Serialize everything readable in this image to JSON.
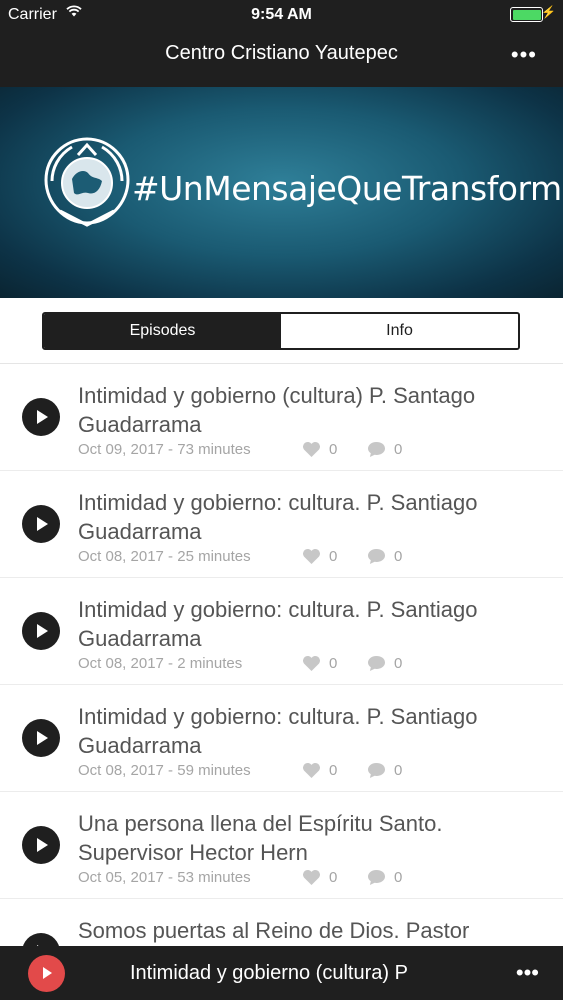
{
  "status": {
    "carrier": "Carrier",
    "time": "9:54 AM",
    "battery_level": 1.0
  },
  "nav": {
    "title": "Centro Cristiano Yautepec",
    "more_icon": "more-dots-icon"
  },
  "banner": {
    "text": "#UnMensajeQueTransforma"
  },
  "tabs": [
    {
      "label": "Episodes",
      "active": true
    },
    {
      "label": "Info",
      "active": false
    }
  ],
  "episodes": [
    {
      "title": "Intimidad y gobierno (cultura) P. Santago Guadarrama",
      "meta": "Oct 09, 2017 - 73 minutes",
      "likes": "0",
      "comments": "0"
    },
    {
      "title": "Intimidad y gobierno: cultura. P. Santiago Guadarrama",
      "meta": "Oct 08, 2017 - 25 minutes",
      "likes": "0",
      "comments": "0"
    },
    {
      "title": "Intimidad y gobierno: cultura. P. Santiago Guadarrama",
      "meta": "Oct 08, 2017 - 2 minutes",
      "likes": "0",
      "comments": "0"
    },
    {
      "title": "Intimidad y gobierno: cultura. P. Santiago Guadarrama",
      "meta": "Oct 08, 2017 - 59 minutes",
      "likes": "0",
      "comments": "0"
    },
    {
      "title": "Una persona llena del Espíritu Santo. Supervisor Hector Hern",
      "meta": "Oct 05, 2017 - 53 minutes",
      "likes": "0",
      "comments": "0"
    },
    {
      "title": "Somos puertas al Reino de Dios. Pastor",
      "meta": "",
      "likes": "",
      "comments": ""
    }
  ],
  "player": {
    "title": "Intimidad y gobierno (cultura) P"
  },
  "colors": {
    "dark": "#1f1f1f",
    "accent": "#e24a4a",
    "battery": "#4cd964"
  }
}
